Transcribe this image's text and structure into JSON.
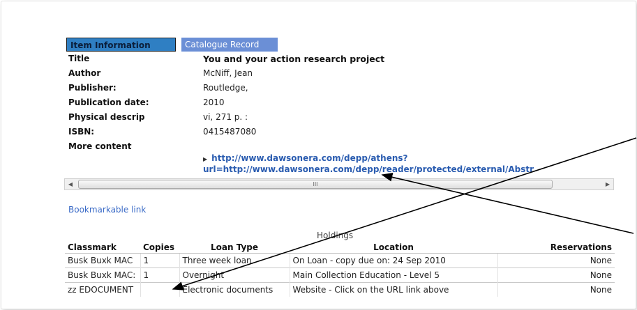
{
  "tabs": {
    "item_information": "Item Information",
    "catalogue_record": "Catalogue Record"
  },
  "record": {
    "title_label": "Title",
    "title_value": "You and your action research project",
    "author_label": "Author",
    "author_value": "McNiff, Jean",
    "publisher_label": "Publisher:",
    "publisher_value": "Routledge,",
    "pubdate_label": "Publication date:",
    "pubdate_value": "2010",
    "physical_label": "Physical descrip",
    "physical_value": "vi, 271 p. :",
    "isbn_label": "ISBN:",
    "isbn_value": "0415487080",
    "more_label": "More content",
    "more_link_line1": "http://www.dawsonera.com/depp/athens?",
    "more_link_line2": "url=http://www.dawsonera.com/depp/reader/protected/external/Abstr"
  },
  "scrollbar": {
    "thumb_grip": "III"
  },
  "bookmark_link": "Bookmarkable link",
  "holdings": {
    "title": "Holdings",
    "columns": [
      "Classmark",
      "Copies",
      "Loan Type",
      "Location",
      "Reservations"
    ],
    "rows": [
      [
        "Busk Buxk MAC",
        "1",
        "Three week loan",
        "On Loan - copy due on: 24 Sep 2010",
        "None"
      ],
      [
        "Busk Buxk MAC:",
        "1",
        "Overnight",
        "Main Collection Education - Level 5",
        "None"
      ],
      [
        "zz EDOCUMENT",
        "",
        "Electronic documents",
        "Website - Click on the URL link above",
        "None"
      ]
    ]
  },
  "colors": {
    "active_tab": "#2f7fc3",
    "inactive_tab": "#6b8fd6",
    "link": "#2a5cb0"
  }
}
